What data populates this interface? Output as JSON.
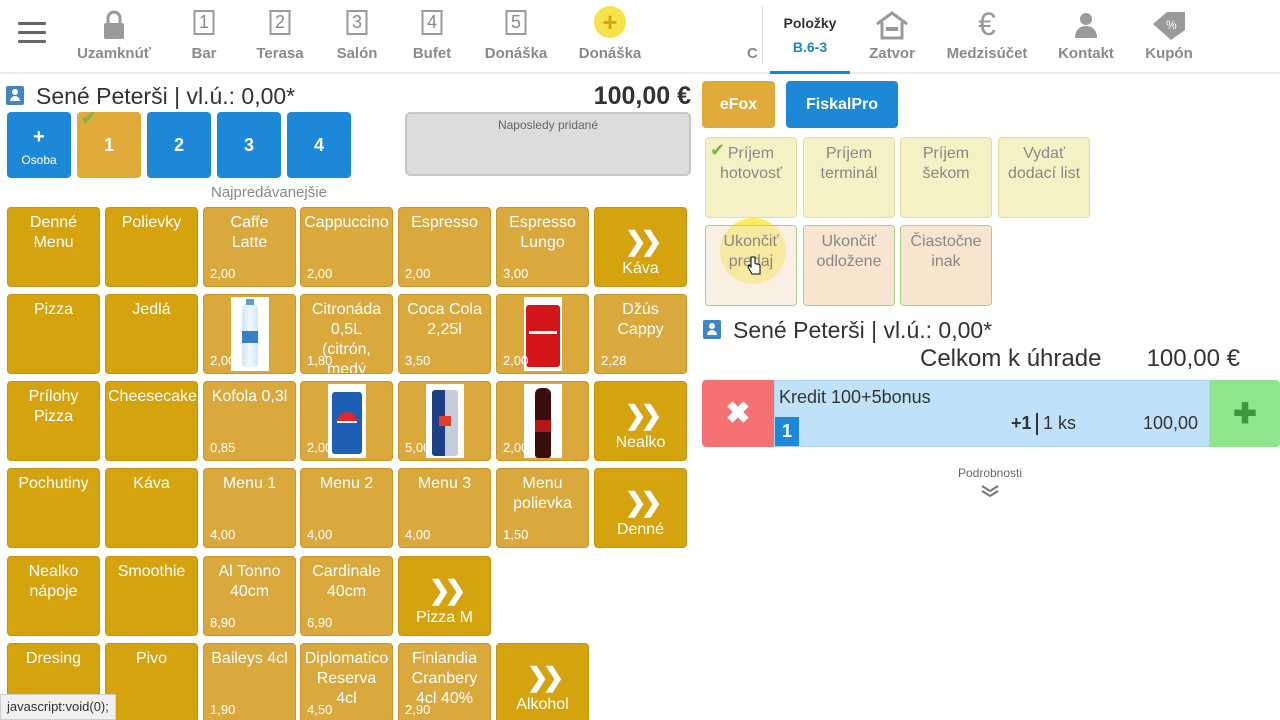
{
  "nav": {
    "menu_icon": "hamburger-icon",
    "tabs": [
      {
        "label": "Uzamknúť",
        "icon": "lock-icon"
      },
      {
        "label": "Bar",
        "num": "1"
      },
      {
        "label": "Terasa",
        "num": "2"
      },
      {
        "label": "Salón",
        "num": "3"
      },
      {
        "label": "Bufet",
        "num": "4"
      },
      {
        "label": "Donáška",
        "num": "5"
      },
      {
        "label": "Donáška",
        "icon": "plus-circle-icon"
      }
    ],
    "cut_label": "C",
    "orders": {
      "title": "Položky",
      "sub": "B.6-3"
    },
    "right_tabs": [
      {
        "label": "Zatvor",
        "icon": "house-icon"
      },
      {
        "label": "Medzisúčet",
        "icon": "euro-icon"
      },
      {
        "label": "Kontakt",
        "icon": "user-icon"
      },
      {
        "label": "Kupón",
        "icon": "coupon-icon"
      }
    ]
  },
  "left": {
    "customer": "Sené Peterši | vl.ú.: 0,00*",
    "total": "100,00 €",
    "persons": {
      "add_plus": "+",
      "add_label": "Osoba",
      "items": [
        "1",
        "2",
        "3",
        "4"
      ]
    },
    "recent_label": "Naposledy pridané",
    "bestsellers_label": "Najpredávanejšie"
  },
  "grid": [
    {
      "name": "Denné\nMenu",
      "type": "cat"
    },
    {
      "name": "Polievky",
      "type": "cat"
    },
    {
      "name": "Caffe\nLatte",
      "price": "2,00"
    },
    {
      "name": "Cappuccino",
      "price": "2,00"
    },
    {
      "name": "Espresso",
      "price": "2,00"
    },
    {
      "name": "Espresso\nLungo",
      "price": "3,00"
    },
    {
      "name": "Káva",
      "type": "more"
    },
    {
      "name": "Pizza",
      "type": "cat"
    },
    {
      "name": "Jedlá",
      "type": "cat"
    },
    {
      "name": "",
      "price": "2,00",
      "img": "water"
    },
    {
      "name": "Citronáda\n0,5L\n(citrón,\nmedý",
      "price": "1,80"
    },
    {
      "name": "Coca Cola\n2,25l",
      "price": "3,50"
    },
    {
      "name": "",
      "price": "2,00",
      "img": "cola"
    },
    {
      "name": "Džús\nCappy",
      "price": "2,28"
    },
    {
      "name": "Prílohy\nPizza",
      "type": "cat"
    },
    {
      "name": "Cheesecake",
      "type": "cat"
    },
    {
      "name": "Kofola 0,3l",
      "price": "0,85"
    },
    {
      "name": "",
      "price": "2,00",
      "img": "pepsi"
    },
    {
      "name": "",
      "price": "5,00",
      "img": "bull"
    },
    {
      "name": "",
      "price": "2,00",
      "img": "kofola"
    },
    {
      "name": "Nealko",
      "type": "more"
    },
    {
      "name": "Pochutiny",
      "type": "cat"
    },
    {
      "name": "Káva",
      "type": "cat"
    },
    {
      "name": "Menu 1",
      "price": "4,00"
    },
    {
      "name": "Menu 2",
      "price": "4,00"
    },
    {
      "name": "Menu 3",
      "price": "4,00"
    },
    {
      "name": "Menu\npolievka",
      "price": "1,50"
    },
    {
      "name": "Denné",
      "type": "more"
    },
    {
      "name": "Nealko\nnápoje",
      "type": "cat"
    },
    {
      "name": "Smoothie",
      "type": "cat"
    },
    {
      "name": "Al Tonno\n40cm",
      "price": "8,90"
    },
    {
      "name": "Cardinale\n40cm",
      "price": "6,90"
    },
    {
      "name": "Pizza M",
      "type": "more"
    },
    {
      "name": "",
      "type": "empty"
    },
    {
      "name": "",
      "type": "empty"
    },
    {
      "name": "Dresing",
      "type": "cat"
    },
    {
      "name": "Pivo",
      "type": "cat"
    },
    {
      "name": "Baileys 4cl",
      "price": "1,90"
    },
    {
      "name": "Diplomatico\nReserva\n4cl",
      "price": "4,50"
    },
    {
      "name": "Finlandia\nCranbery\n4cl 40%",
      "price": "2,90"
    },
    {
      "name": "Alkohol",
      "type": "more"
    },
    {
      "name": "",
      "type": "empty"
    }
  ],
  "right": {
    "efox": "eFox",
    "fiskal": "FiskalPro",
    "payments": [
      "Príjem\nhotovosť",
      "Príjem\nterminál",
      "Príjem\nšekom",
      "Vydať\ndodací list",
      "Ukončiť\npredaj",
      "Ukončiť\nodložene",
      "Čiastočne\ninak"
    ],
    "customer": "Sené Peterši | vl.ú.: 0,00*",
    "total_label": "Celkom k úhrade",
    "total_value": "100,00 €",
    "item": {
      "name": "Kredit 100+5bonus",
      "badge": "1",
      "incr": "+1",
      "qty": "1 ks",
      "price": "100,00"
    },
    "details": "Podrobnosti"
  },
  "status": "javascript:void(0);"
}
